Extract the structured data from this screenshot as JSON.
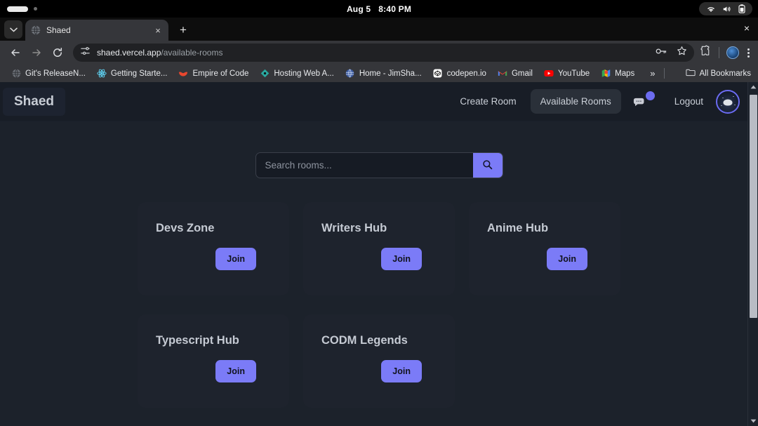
{
  "os": {
    "clock_date": "Aug 5",
    "clock_time": "8:40 PM",
    "tray_icons": [
      "wifi-icon",
      "volume-icon",
      "battery-icon"
    ]
  },
  "browser": {
    "tab": {
      "title": "Shaed",
      "favicon": "globe-icon",
      "close_label": "×"
    },
    "new_tab_label": "+",
    "window_close_label": "×",
    "tab_list_label": "⌄",
    "toolbar": {
      "back_label": "←",
      "forward_label": "→",
      "reload_label": "↻",
      "site_info_icon": "tune-icon",
      "url_host": "shaed.vercel.app",
      "url_path": "/available-rooms",
      "password_icon": "key-icon",
      "bookmark_icon": "star-icon",
      "extensions_icon": "puzzle-icon",
      "profile_icon": "avatar-icon",
      "menu_icon": "kebab-icon"
    },
    "bookmarks": [
      {
        "label": "Git's ReleaseN...",
        "icon": "globe-icon"
      },
      {
        "label": "Getting Starte...",
        "icon": "react-icon"
      },
      {
        "label": "Empire of Code",
        "icon": "shield-icon"
      },
      {
        "label": "Hosting Web A...",
        "icon": "diamond-icon"
      },
      {
        "label": "Home - JimSha...",
        "icon": "globe-blue-icon"
      },
      {
        "label": "codepen.io",
        "icon": "codepen-icon"
      },
      {
        "label": "Gmail",
        "icon": "gmail-icon"
      },
      {
        "label": "YouTube",
        "icon": "youtube-icon"
      },
      {
        "label": "Maps",
        "icon": "maps-icon"
      }
    ],
    "bookmarks_overflow_label": "»",
    "all_bookmarks_label": "All Bookmarks",
    "all_bookmarks_icon": "folder-icon"
  },
  "app": {
    "brand": "Shaed",
    "nav": {
      "create_room": "Create Room",
      "available_rooms": "Available Rooms",
      "logout": "Logout",
      "chat_icon": "chat-bubble-icon",
      "avatar_icon": "user-avatar"
    },
    "search": {
      "placeholder": "Search rooms...",
      "value": "",
      "button_icon": "search-icon"
    },
    "rooms": [
      {
        "name": "Devs Zone",
        "action": "Join"
      },
      {
        "name": "Writers Hub",
        "action": "Join"
      },
      {
        "name": "Anime Hub",
        "action": "Join"
      },
      {
        "name": "Typescript Hub",
        "action": "Join"
      },
      {
        "name": "CODM Legends",
        "action": "Join"
      }
    ]
  },
  "colors": {
    "accent": "#7b7bf7",
    "page_bg": "#1c222b",
    "header_bg": "#181d26",
    "card_bg": "#1e232d",
    "badge": "#6c6cf0"
  }
}
